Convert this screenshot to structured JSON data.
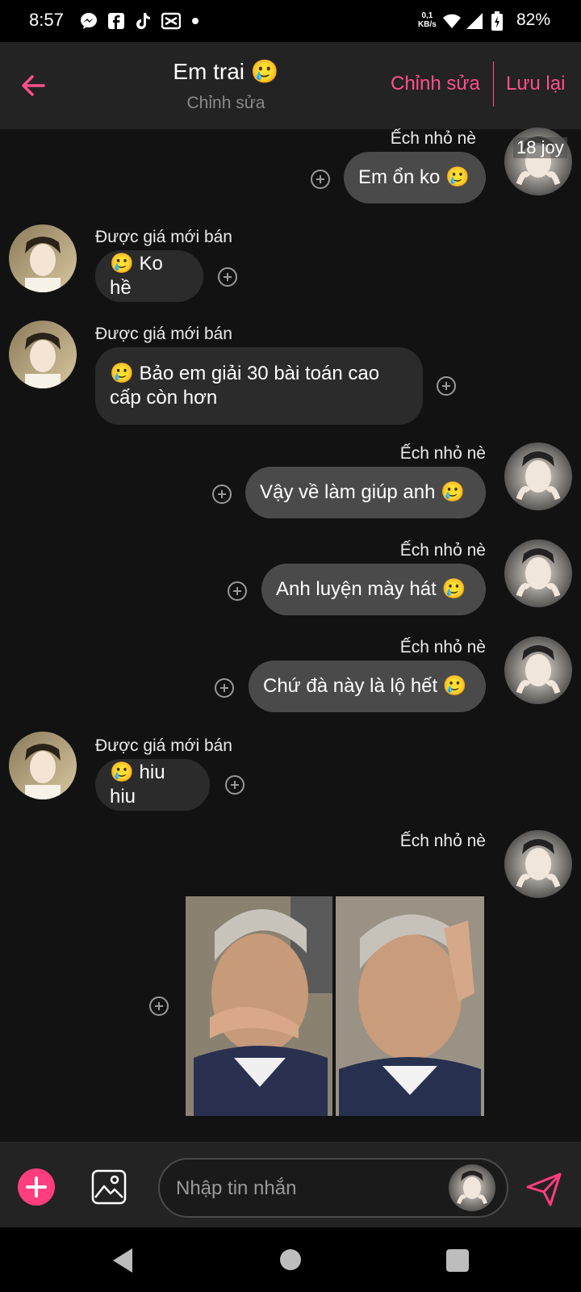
{
  "status_bar": {
    "time": "8:57",
    "net_speed_value": "0,1",
    "net_speed_unit": "KB/s",
    "battery": "82%",
    "icons": [
      "messenger-icon",
      "facebook-icon",
      "tiktok-icon",
      "capcut-icon",
      "dot-icon",
      "wifi-icon",
      "signal-icon",
      "battery-icon"
    ]
  },
  "header": {
    "title": "Em trai 🥲",
    "subtitle": "Chỉnh sửa",
    "edit_label": "Chỉnh sửa",
    "save_label": "Lưu lại"
  },
  "sticker_label": "18 joy",
  "messages": [
    {
      "sender": "Ếch nhỏ nè",
      "text": "Em ổn ko 🥲",
      "direction": "out"
    },
    {
      "sender": "Được giá mới bán",
      "text": "🥲 Ko hề",
      "direction": "in"
    },
    {
      "sender": "Được giá mới bán",
      "text": "🥲 Bảo em giải 30 bài toán cao cấp còn hơn",
      "direction": "in"
    },
    {
      "sender": "Ếch nhỏ nè",
      "text": "Vậy về làm giúp anh 🥲",
      "direction": "out"
    },
    {
      "sender": "Ếch nhỏ nè",
      "text": "Anh luyện mày hát 🥲",
      "direction": "out"
    },
    {
      "sender": "Ếch nhỏ nè",
      "text": "Chứ đà này là lộ hết 🥲",
      "direction": "out"
    },
    {
      "sender": "Được giá mới bán",
      "text": "🥲 hiu hiu",
      "direction": "in"
    },
    {
      "sender": "Ếch nhỏ nè",
      "text": "",
      "direction": "out",
      "attachment": "photo"
    }
  ],
  "composer": {
    "placeholder": "Nhập tin nhắn"
  },
  "colors": {
    "accent": "#ff4f8c",
    "background": "#121212",
    "header": "#232323",
    "bubble_out": "#4a4a4a",
    "bubble_in": "#2b2b2b"
  }
}
